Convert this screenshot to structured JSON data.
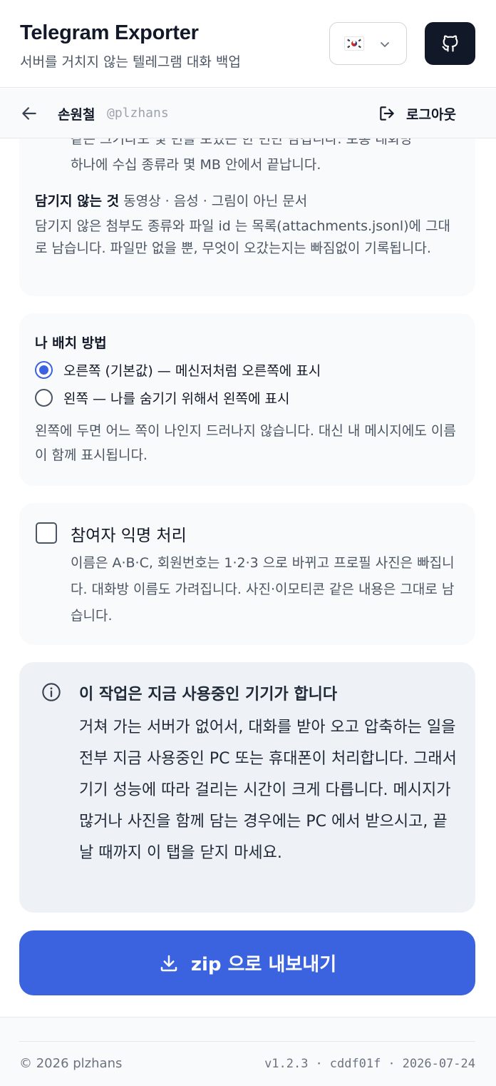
{
  "header": {
    "title": "Telegram Exporter",
    "subtitle": "서버를 거치지 않는 텔레그램 대화 백업",
    "language_flag": "korea-flag-icon",
    "github_icon": "github-icon"
  },
  "subnav": {
    "user_name": "손원철",
    "user_handle": "@plzhans",
    "logout_label": "로그아웃"
  },
  "attachments": {
    "cut_line": "같은 크기라도 몇 번을 보였든 한 번만 담깁니다. 보통 대화방",
    "line2": "하나에 수십 종류라 몇 MB 안에서 끝납니다.",
    "excluded_label": "담기지 않는 것",
    "excluded_items": " 동영상 · 음성 · 그림이 아닌 문서",
    "excluded_note": "담기지 않은 첨부도 종류와 파일 id 는 목록(attachments.jsonl)에 그대로 남습니다. 파일만 없을 뿐, 무엇이 오갔는지는 빠짐없이 기록됩니다."
  },
  "my_position": {
    "label": "나 배치 방법",
    "options": [
      {
        "label": "오른쪽 (기본값) — 메신저처럼 오른쪽에 표시",
        "checked": true
      },
      {
        "label": "왼쪽 — 나를 숨기기 위해서 왼쪽에 표시",
        "checked": false
      }
    ],
    "note": "왼쪽에 두면 어느 쪽이 나인지 드러나지 않습니다. 대신 내 메시지에도 이름이 함께 표시됩니다."
  },
  "anonymize": {
    "title": "참여자 익명 처리",
    "checked": false,
    "description": "이름은 A·B·C, 회원번호는 1·2·3 으로 바뀌고 프로필 사진은 빠집니다. 대화방 이름도 가려집니다. 사진·이모티콘 같은 내용은 그대로 남습니다."
  },
  "info": {
    "title": "이 작업은 지금 사용중인 기기가 합니다",
    "body": "거쳐 가는 서버가 없어서, 대화를 받아 오고 압축하는 일을 전부 지금 사용중인 PC 또는 휴대폰이 처리합니다. 그래서 기기 성능에 따라 걸리는 시간이 크게 다릅니다. 메시지가 많거나 사진을 함께 담는 경우에는 PC 에서 받으시고, 끝날 때까지 이 탭을 닫지 마세요."
  },
  "export_button": {
    "label": "zip 으로 내보내기"
  },
  "footer": {
    "copyright": "© 2026 plzhans",
    "version": "v1.2.3",
    "sep1": "·",
    "commit": "cddf01f",
    "sep2": "·",
    "date": "2026-07-24"
  },
  "colors": {
    "accent": "#3b63e0",
    "dark_button": "#111827",
    "card_bg": "#f9fafb",
    "info_bg": "#eef1f6"
  }
}
